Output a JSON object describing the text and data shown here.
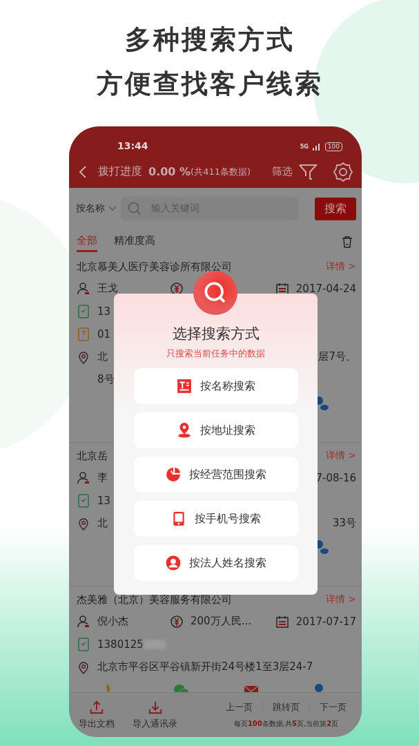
{
  "headline": [
    "多种搜索方式",
    "方便查找客户线索"
  ],
  "status_bar": {
    "time": "13:44",
    "network": "5G",
    "battery": "100"
  },
  "header": {
    "title": "拨打进度",
    "progress": "0.00 %",
    "count": "(共411条数据)",
    "filter": "筛选"
  },
  "search": {
    "mode": "按名称",
    "placeholder": "输入关键词",
    "button": "搜索"
  },
  "tabs": [
    {
      "label": "全部",
      "selected": true
    },
    {
      "label": "精准度高",
      "selected": false
    }
  ],
  "cards": [
    {
      "title": "北京慕美人医疗美容诊所有限公司",
      "detail": "详情 >",
      "rows": [
        {
          "left": {
            "kind": "person",
            "text": "王戈"
          },
          "middle": {
            "kind": "money"
          },
          "right": {
            "kind": "calendar",
            "text": "2017-04-24"
          }
        },
        {
          "left": {
            "kind": "mobile",
            "text": "13"
          }
        },
        {
          "left": {
            "kind": "tel",
            "text": "01"
          }
        },
        {
          "left": {
            "kind": "location",
            "text": "北"
          },
          "right": {
            "text": "层7号、"
          }
        },
        {
          "left": {
            "text": "8号"
          }
        }
      ],
      "actions": [
        {
          "kind": "contacts"
        }
      ]
    },
    {
      "title": "北京岳",
      "detail": "详情 >",
      "rows": [
        {
          "left": {
            "kind": "person",
            "text": "李"
          },
          "right": {
            "text": "7-08-16"
          }
        },
        {
          "left": {
            "kind": "mobile",
            "text": "13"
          }
        },
        {
          "left": {
            "kind": "location",
            "text": "北"
          },
          "right": {
            "text": "33号"
          }
        }
      ],
      "actions": [
        {
          "kind": "contacts"
        }
      ]
    },
    {
      "title": "杰美雅（北京）美容服务有限公司",
      "detail": "详情 >",
      "rows": [
        {
          "left": {
            "kind": "person",
            "text": "倪小杰"
          },
          "middle": {
            "kind": "money",
            "text": "200万人民..."
          },
          "right": {
            "kind": "calendar",
            "text": "2017-07-17"
          }
        },
        {
          "left": {
            "kind": "mobile",
            "text": "1380125",
            "blurred": true
          }
        },
        {
          "left": {
            "kind": "location",
            "text": "北京市平谷区平谷镇新开街24号楼1至3层24-7"
          }
        }
      ],
      "actions": [
        {
          "kind": "call"
        },
        {
          "kind": "wechat"
        },
        {
          "kind": "mail"
        },
        {
          "kind": "contacts"
        }
      ]
    }
  ],
  "modal": {
    "title": "选择搜索方式",
    "subtitle": "只搜索当前任务中的数据",
    "options": [
      {
        "kind": "name",
        "label": "按名称搜索"
      },
      {
        "kind": "address",
        "label": "按地址搜索"
      },
      {
        "kind": "business",
        "label": "按经营范围搜索"
      },
      {
        "kind": "mobile",
        "label": "按手机号搜索"
      },
      {
        "kind": "legal_person",
        "label": "按法人姓名搜索"
      }
    ]
  },
  "bottom_bar": {
    "actions": [
      {
        "kind": "export",
        "label": "导出文档"
      },
      {
        "kind": "import",
        "label": "导入通讯录"
      }
    ],
    "pager": [
      "上一页",
      "跳转页",
      "下一页"
    ],
    "page_info": "每页**100**条数据,共**5**页,当前第**2**页"
  }
}
